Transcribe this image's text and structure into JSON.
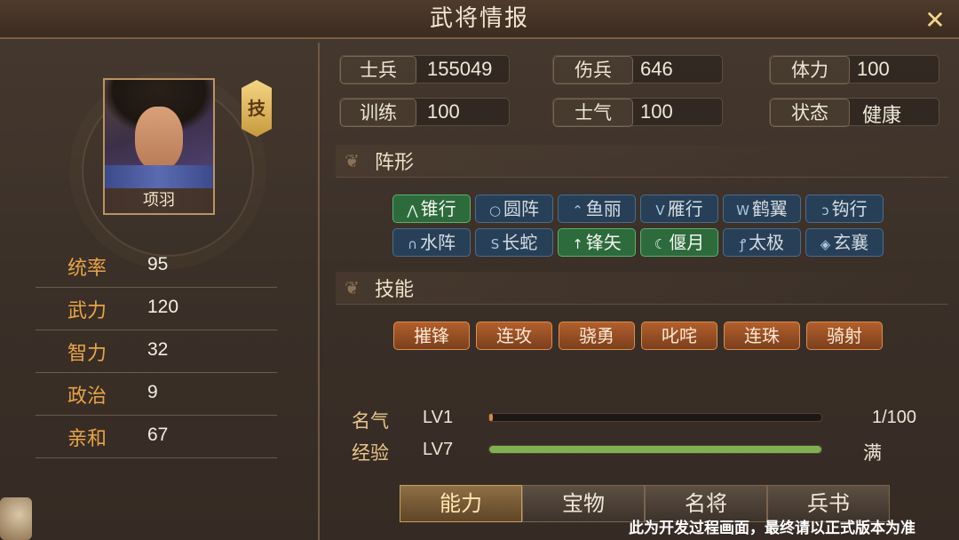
{
  "window": {
    "title": "武将情报",
    "close_icon": "close-icon"
  },
  "general": {
    "name": "项羽",
    "skill_tag": "技"
  },
  "stats": [
    {
      "label": "统率",
      "value": "95"
    },
    {
      "label": "武力",
      "value": "120"
    },
    {
      "label": "智力",
      "value": "32"
    },
    {
      "label": "政治",
      "value": "9"
    },
    {
      "label": "亲和",
      "value": "67"
    }
  ],
  "info": {
    "soldiers_label": "士兵",
    "soldiers_value": "155049",
    "wounded_label": "伤兵",
    "wounded_value": "646",
    "stamina_label": "体力",
    "stamina_value": "100",
    "training_label": "训练",
    "training_value": "100",
    "morale_label": "士气",
    "morale_value": "100",
    "status_label": "状态",
    "status_value": "健康"
  },
  "formation_section": {
    "title": "阵形"
  },
  "formations": [
    {
      "label": "锥行",
      "icon": "arrow-up-icon",
      "glyph": "⋀",
      "on": true
    },
    {
      "label": "圆阵",
      "icon": "circle-icon",
      "glyph": "○",
      "on": false
    },
    {
      "label": "鱼丽",
      "icon": "chevron-stack-icon",
      "glyph": "⌃",
      "on": false
    },
    {
      "label": "雁行",
      "icon": "v-icon",
      "glyph": "V",
      "on": false
    },
    {
      "label": "鹤翼",
      "icon": "w-icon",
      "glyph": "W",
      "on": false
    },
    {
      "label": "钩行",
      "icon": "hook-icon",
      "glyph": "ↄ",
      "on": false
    },
    {
      "label": "水阵",
      "icon": "arch-icon",
      "glyph": "∩",
      "on": false
    },
    {
      "label": "长蛇",
      "icon": "snake-icon",
      "glyph": "S",
      "on": false
    },
    {
      "label": "锋矢",
      "icon": "arrow-icon",
      "glyph": "↑",
      "on": true
    },
    {
      "label": "偃月",
      "icon": "crescent-icon",
      "glyph": "☾",
      "on": true
    },
    {
      "label": "太极",
      "icon": "taiji-icon",
      "glyph": "ꝭ",
      "on": false
    },
    {
      "label": "玄襄",
      "icon": "diamond-icon",
      "glyph": "◈",
      "on": false
    }
  ],
  "skill_section": {
    "title": "技能"
  },
  "skills": [
    "摧锋",
    "连攻",
    "骁勇",
    "叱咤",
    "连珠",
    "骑射"
  ],
  "fame": {
    "label": "名气",
    "level": "LV1",
    "progress": 0.01,
    "value_text": "1/100"
  },
  "exp": {
    "label": "经验",
    "level": "LV7",
    "progress": 1.0,
    "value_text": "满"
  },
  "tabs": [
    {
      "label": "能力",
      "active": true
    },
    {
      "label": "宝物",
      "active": false
    },
    {
      "label": "名将",
      "active": false
    },
    {
      "label": "兵书",
      "active": false
    }
  ],
  "footnote": "此为开发过程画面，最终请以正式版本为准",
  "colors": {
    "accent": "#e8a347",
    "formation_on": "#2d6a3c",
    "formation_off": "#274058",
    "skill": "#b25f2c",
    "exp_bar": "#7fb052",
    "fame_bar": "#d98a3a"
  }
}
